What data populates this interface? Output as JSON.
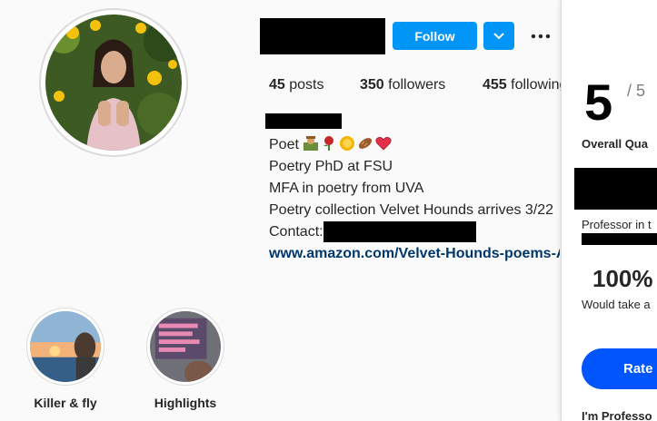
{
  "profile": {
    "follow_label": "Follow",
    "stats": {
      "posts_count": "45",
      "posts_label": "posts",
      "followers_count": "350",
      "followers_label": "followers",
      "following_count": "455",
      "following_label": "following"
    },
    "bio": {
      "line1_prefix": "Poet",
      "line2": "Poetry PhD at FSU",
      "line3": "MFA in poetry from UVA",
      "line4": "Poetry collection Velvet Hounds arrives 3/22",
      "contact_label": "Contact:",
      "link": "www.amazon.com/Velvet-Hounds-poems-Ak"
    }
  },
  "highlights": [
    {
      "label": "Killer & fly"
    },
    {
      "label": "Highlights"
    }
  ],
  "rmp_panel": {
    "score": "5",
    "score_of": "/ 5",
    "quality_label": "Overall Qua",
    "role_text": "Professor in t",
    "percent": "100%",
    "would_take": "Would take a",
    "rate_button": "Rate",
    "footer": "I'm Professo"
  },
  "colors": {
    "follow_blue": "#0095f6",
    "link_blue": "#00376b",
    "rate_blue": "#0055fd"
  }
}
